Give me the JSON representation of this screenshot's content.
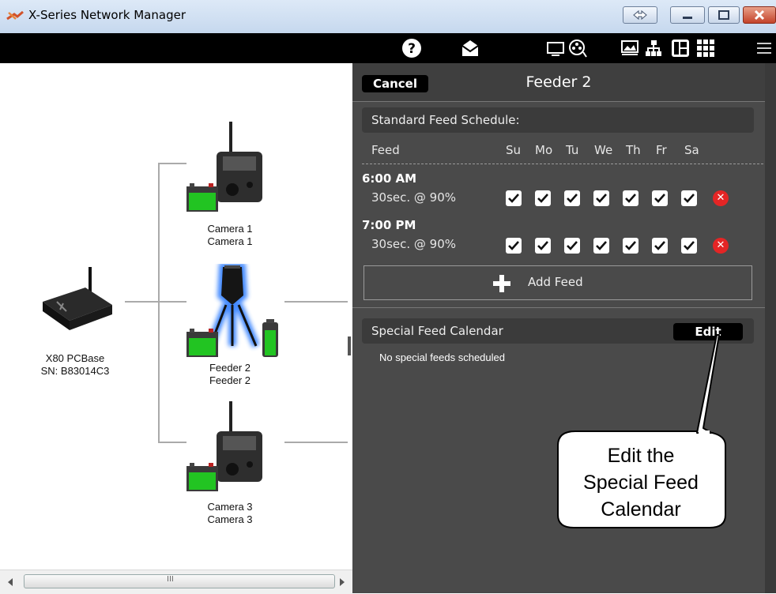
{
  "window": {
    "title": "X-Series Network Manager"
  },
  "toolbar": {
    "icons": [
      "help-icon",
      "mail-icon",
      "monitor-icon",
      "film-icon",
      "image-icon",
      "network-icon",
      "layout-icon",
      "grid-icon",
      "menu-icon"
    ]
  },
  "diagram": {
    "base": {
      "line1": "X80 PCBase",
      "line2": "SN: B83014C3"
    },
    "camera1": {
      "line1": "Camera 1",
      "line2": "Camera 1"
    },
    "feeder2": {
      "line1": "Feeder 2",
      "line2": "Feeder 2"
    },
    "camera3": {
      "line1": "Camera 3",
      "line2": "Camera 3"
    }
  },
  "panel": {
    "cancel_label": "Cancel",
    "title": "Feeder 2",
    "standard_section": "Standard Feed Schedule:",
    "feed_header": "Feed",
    "days": [
      "Su",
      "Mo",
      "Tu",
      "We",
      "Th",
      "Fr",
      "Sa"
    ],
    "feeds": [
      {
        "time": "6:00 AM",
        "duration": "30sec. @ 90%",
        "days_checked": [
          true,
          true,
          true,
          true,
          true,
          true,
          true
        ]
      },
      {
        "time": "7:00 PM",
        "duration": "30sec. @ 90%",
        "days_checked": [
          true,
          true,
          true,
          true,
          true,
          true,
          true
        ]
      }
    ],
    "add_feed_label": "Add Feed",
    "special_section": "Special Feed Calendar",
    "edit_label": "Edit",
    "no_special": "No special feeds scheduled"
  },
  "callout": {
    "line1": "Edit the",
    "line2": "Special Feed",
    "line3": "Calendar"
  },
  "scrollbar": {
    "grip": "III"
  },
  "colors": {
    "panel_bg": "#4a4a4a",
    "toolbar_bg": "#000000",
    "delete_red": "#e42525",
    "battery_green": "#22c422",
    "highlight_blue": "#2f7dff"
  }
}
